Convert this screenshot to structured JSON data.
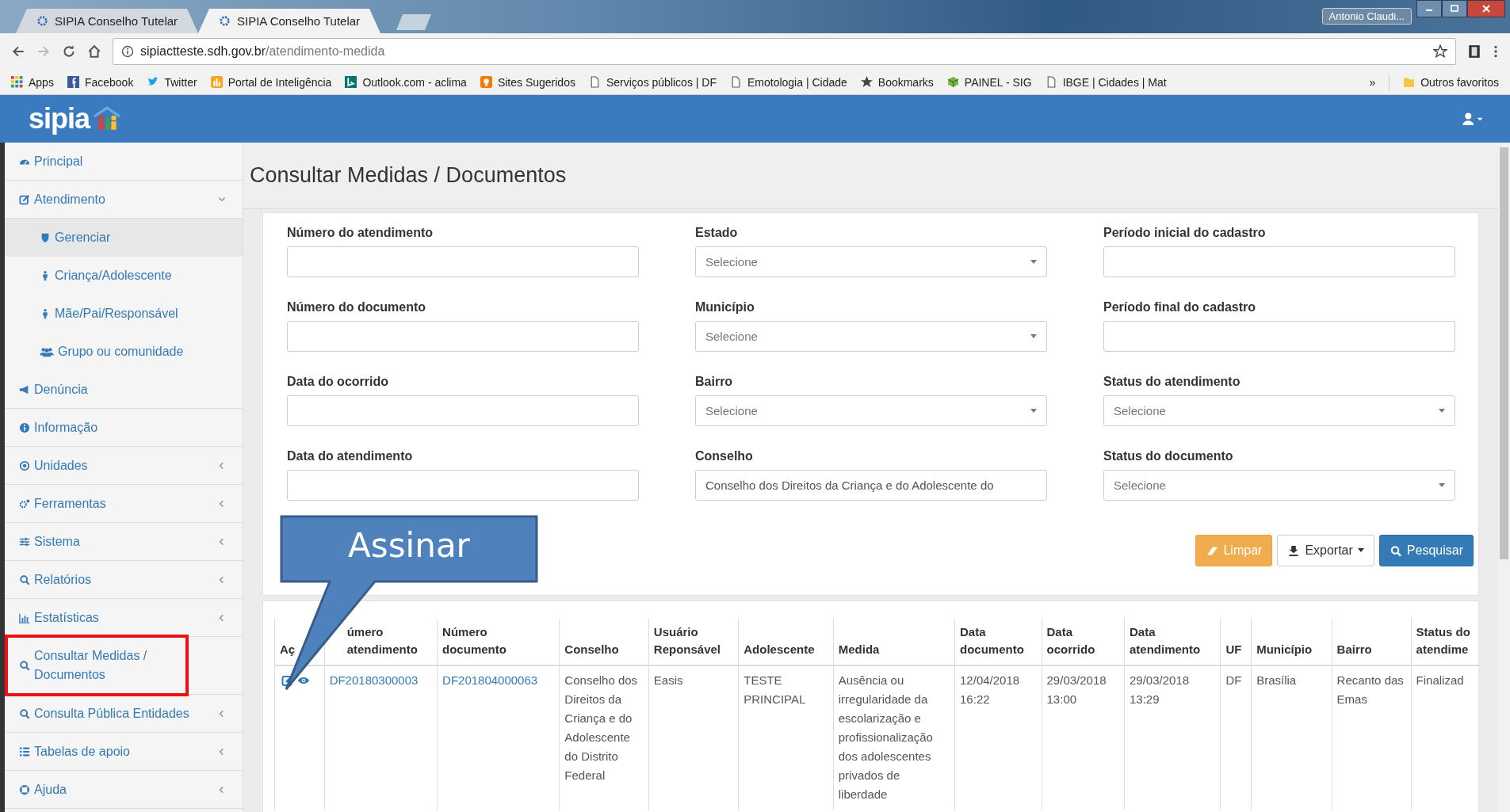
{
  "browser": {
    "tabs": [
      {
        "title": "SIPIA Conselho Tutelar",
        "selected": false
      },
      {
        "title": "SIPIA Conselho Tutelar",
        "selected": true
      }
    ],
    "profile": "Antonio Claudi...",
    "url_host": "sipiactteste.sdh.gov.br",
    "url_path": "/atendimento-medida",
    "bookmarks": [
      "Apps",
      "Facebook",
      "Twitter",
      "Portal de Inteligência",
      "Outlook.com - aclima",
      "Sites Sugeridos",
      "Serviços públicos | DF",
      "Emotologia | Cidade",
      "Bookmarks",
      "PAINEL - SIG",
      "IBGE | Cidades | Mat"
    ],
    "overflow": "»",
    "other_bookmarks": "Outros favoritos"
  },
  "app": {
    "logo": "sipia"
  },
  "sidebar": {
    "items": [
      {
        "label": "Principal"
      },
      {
        "label": "Atendimento",
        "expanded": true,
        "children": [
          {
            "label": "Gerenciar",
            "selected": true
          },
          {
            "label": "Criança/Adolescente",
            "selected": false
          },
          {
            "label": "Mãe/Pai/Responsável",
            "selected": false
          },
          {
            "label": "Grupo ou comunidade",
            "selected": false
          }
        ]
      },
      {
        "label": "Denúncia"
      },
      {
        "label": "Informação"
      },
      {
        "label": "Unidades",
        "expanded": false
      },
      {
        "label": "Ferramentas",
        "expanded": false
      },
      {
        "label": "Sistema",
        "expanded": false
      },
      {
        "label": "Relatórios",
        "expanded": false
      },
      {
        "label": "Estatísticas",
        "expanded": false
      },
      {
        "label": "Consultar Medidas / Documentos",
        "annotated": true
      },
      {
        "label": "Consulta Pública Entidades",
        "expanded": false
      },
      {
        "label": "Tabelas de apoio",
        "expanded": false
      },
      {
        "label": "Ajuda",
        "expanded": false
      }
    ]
  },
  "page": {
    "title": "Consultar Medidas / Documentos"
  },
  "form": {
    "fields": [
      {
        "label": "Número do atendimento",
        "kind": "text"
      },
      {
        "label": "Estado",
        "kind": "select",
        "placeholder": "Selecione"
      },
      {
        "label": "Período inicial do cadastro",
        "kind": "text"
      },
      {
        "label": "Número do documento",
        "kind": "text"
      },
      {
        "label": "Município",
        "kind": "select",
        "placeholder": "Selecione"
      },
      {
        "label": "Período final do cadastro",
        "kind": "text"
      },
      {
        "label": "Data do ocorrido",
        "kind": "text"
      },
      {
        "label": "Bairro",
        "kind": "select",
        "placeholder": "Selecione"
      },
      {
        "label": "Status do atendimento",
        "kind": "select",
        "placeholder": "Selecione"
      },
      {
        "label": "Data do atendimento",
        "kind": "text"
      },
      {
        "label": "Conselho",
        "kind": "text",
        "value": "Conselho dos Direitos da Criança e do Adolescente do"
      },
      {
        "label": "Status do documento",
        "kind": "select",
        "placeholder": "Selecione"
      }
    ],
    "buttons": [
      {
        "label": "Limpar",
        "kind": "warning"
      },
      {
        "label": "Exportar",
        "kind": "default",
        "dropdown": true
      },
      {
        "label": "Pesquisar",
        "kind": "primary"
      }
    ]
  },
  "table": {
    "columns": [
      "Aç",
      "úmero atendimento",
      "Número documento",
      "Conselho",
      "Usuário Reponsável",
      "Adolescente",
      "Medida",
      "Data documento",
      "Data ocorrido",
      "Data atendimento",
      "UF",
      "Município",
      "Bairro",
      "Status do atendime"
    ],
    "rows": [
      {
        "cells": [
          {
            "kind": "actions"
          },
          {
            "kind": "link",
            "text": "DF20180300003"
          },
          {
            "kind": "link",
            "text": "DF201804000063"
          },
          {
            "kind": "text",
            "text": "Conselho dos Direitos da Criança e do Adolescente do Distrito Federal"
          },
          {
            "kind": "text",
            "text": "Easis"
          },
          {
            "kind": "text",
            "text": "TESTE PRINCIPAL"
          },
          {
            "kind": "text",
            "text": "Ausência ou irregularidade da escolarização e profissionalização dos adolescentes privados de liberdade"
          },
          {
            "kind": "text",
            "text": "12/04/2018 16:22"
          },
          {
            "kind": "text",
            "text": "29/03/2018 13:00"
          },
          {
            "kind": "text",
            "text": "29/03/2018 13:29"
          },
          {
            "kind": "text",
            "text": "DF"
          },
          {
            "kind": "text",
            "text": "Brasília"
          },
          {
            "kind": "text",
            "text": "Recanto das Emas"
          },
          {
            "kind": "text",
            "text": "Finalizad"
          }
        ]
      }
    ]
  },
  "annotation": {
    "callout": "Assinar"
  }
}
